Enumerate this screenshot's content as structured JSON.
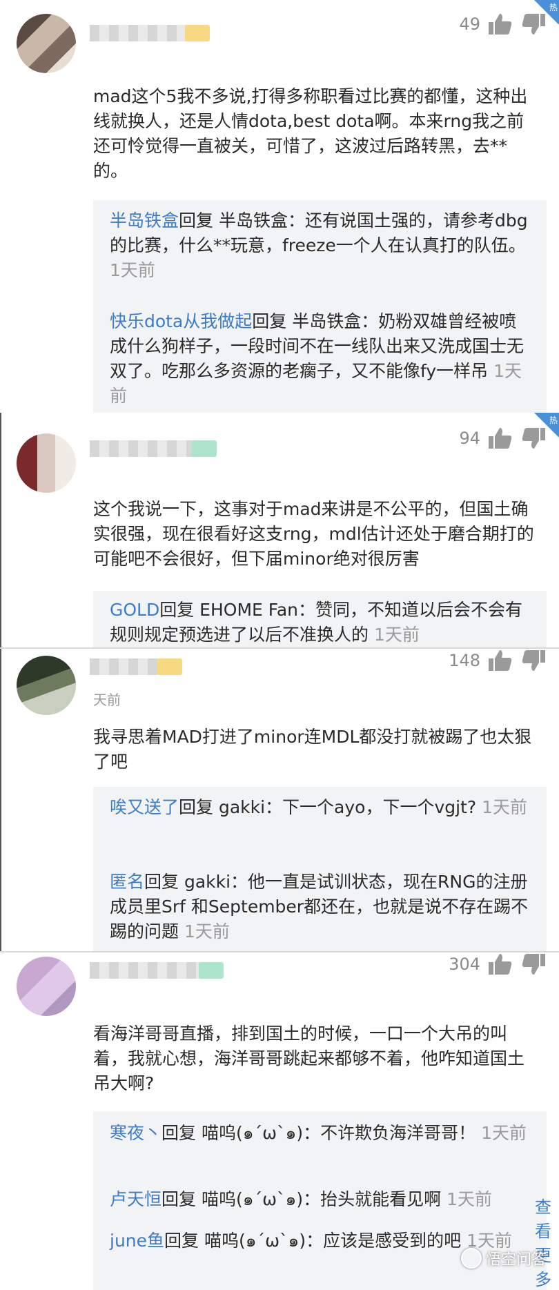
{
  "comments": [
    {
      "likes": "49",
      "hot": true,
      "text": "mad这个5我不多说,打得多称职看过比赛的都懂，这种出线就换人，还是人情dota,best dota啊。本来rng我之前还可怜觉得一直被关，可惜了，这波过后路转黑，去**的。",
      "replies": [
        {
          "name": "半岛铁盒",
          "text": "回复 半岛铁盒：还有说国土强的，请参考dbg的比赛，什么**玩意，freeze一个人在认真打的队伍。",
          "time": "1天前"
        },
        {
          "name": "快乐dota从我做起",
          "text": "回复 半岛铁盒：奶粉双雄曾经被喷成什么狗样子，一段时间不在一线队出来又洗成国士无双了。吃那么多资源的老瘸子，又不能像fy一样吊",
          "time": "1天前"
        }
      ]
    },
    {
      "likes": "94",
      "hot": true,
      "text": "这个我说一下，这事对于mad来讲是不公平的，但国土确实很强，现在很看好这支rng，mdl估计还处于磨合期打的可能吧不会很好，但下届minor绝对很厉害",
      "replies": [
        {
          "name": "GOLD",
          "text": "回复 EHOME Fan：赞同，不知道以后会不会有规则规定预选进了以后不准换人的",
          "time": "1天前"
        }
      ]
    },
    {
      "likes": "148",
      "hot": false,
      "faded_time": "天前",
      "text": "我寻思着MAD打进了minor连MDL都没打就被踢了也太狠了吧",
      "replies": [
        {
          "name": "唉又送了",
          "text": "回复 gakki：下一个ayo，下一个vgjt?",
          "time": "1天前"
        },
        {
          "name": "匿名",
          "text": "回复 gakki：他一直是试训状态，现在RNG的注册成员里Srf 和September都还在，也就是说不存在踢不踢的问题",
          "time": "1天前"
        }
      ]
    },
    {
      "likes": "304",
      "hot": false,
      "text": "看海洋哥哥直播，排到国土的时候，一口一个大吊的叫着，我就心想，海洋哥哥跳起来都够不着，他咋知道国土吊大啊?",
      "replies": [
        {
          "name": "寒夜丶",
          "text": "回复 喵呜(๑´ω`๑)：不许欺负海洋哥哥！",
          "time": "1天前"
        },
        {
          "name": "卢天恒",
          "text": "回复 喵呜(๑´ω`๑)：抬头就能看见啊",
          "time": "1天前"
        },
        {
          "name": "june鱼",
          "text": "回复 喵呜(๑´ω`๑)：应该是感受到的吧",
          "time": "1天前"
        }
      ]
    }
  ],
  "hot_label": "热",
  "watermark": "悟空问答",
  "more_label": "查看更多"
}
